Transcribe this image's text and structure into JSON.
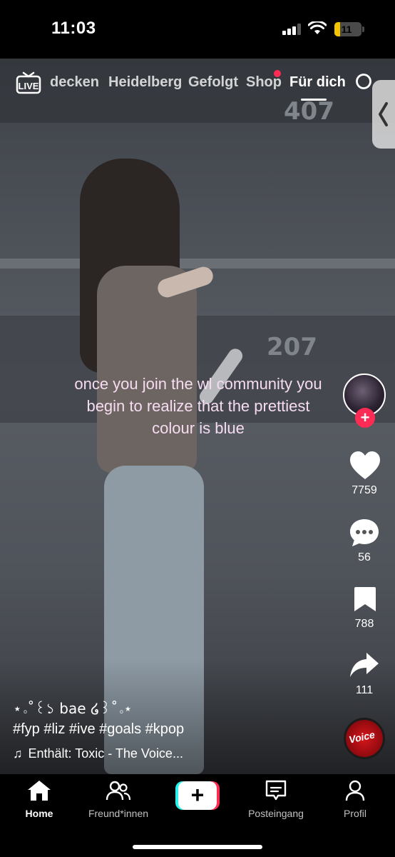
{
  "status_bar": {
    "time": "11:03",
    "battery": "11",
    "battery_level": 0.11
  },
  "top_tabs": {
    "live_label": "LIVE",
    "tabs": [
      {
        "label": "decken"
      },
      {
        "label": "Heidelberg"
      },
      {
        "label": "Gefolgt"
      },
      {
        "label": "Shop"
      },
      {
        "label": "Für dich",
        "active": true
      }
    ]
  },
  "video": {
    "section_numbers": [
      "407",
      "207"
    ],
    "caption": "once you join the wl community you begin to realize that the prettiest colour is blue"
  },
  "right_rail": {
    "likes": "7759",
    "comments": "56",
    "bookmarks": "788",
    "shares": "111",
    "music_disc_text": "Voice"
  },
  "post": {
    "username": "⋆｡˚꒰১ bae ໒꒱˚｡⋆",
    "hashtags": "#fyp #liz #ive #goals #kpop",
    "sound": "Enthält: Toxic - The Voice..."
  },
  "bottom_nav": {
    "items": [
      {
        "label": "Home",
        "active": true
      },
      {
        "label": "Freund*innen"
      },
      {
        "label": "Posteingang"
      },
      {
        "label": "Profil"
      }
    ],
    "create_symbol": "+"
  },
  "colors": {
    "accent_red": "#fe2c55",
    "accent_cyan": "#25f4ee",
    "caption_pink": "#f7dcf1",
    "battery_yellow": "#f5c400"
  }
}
